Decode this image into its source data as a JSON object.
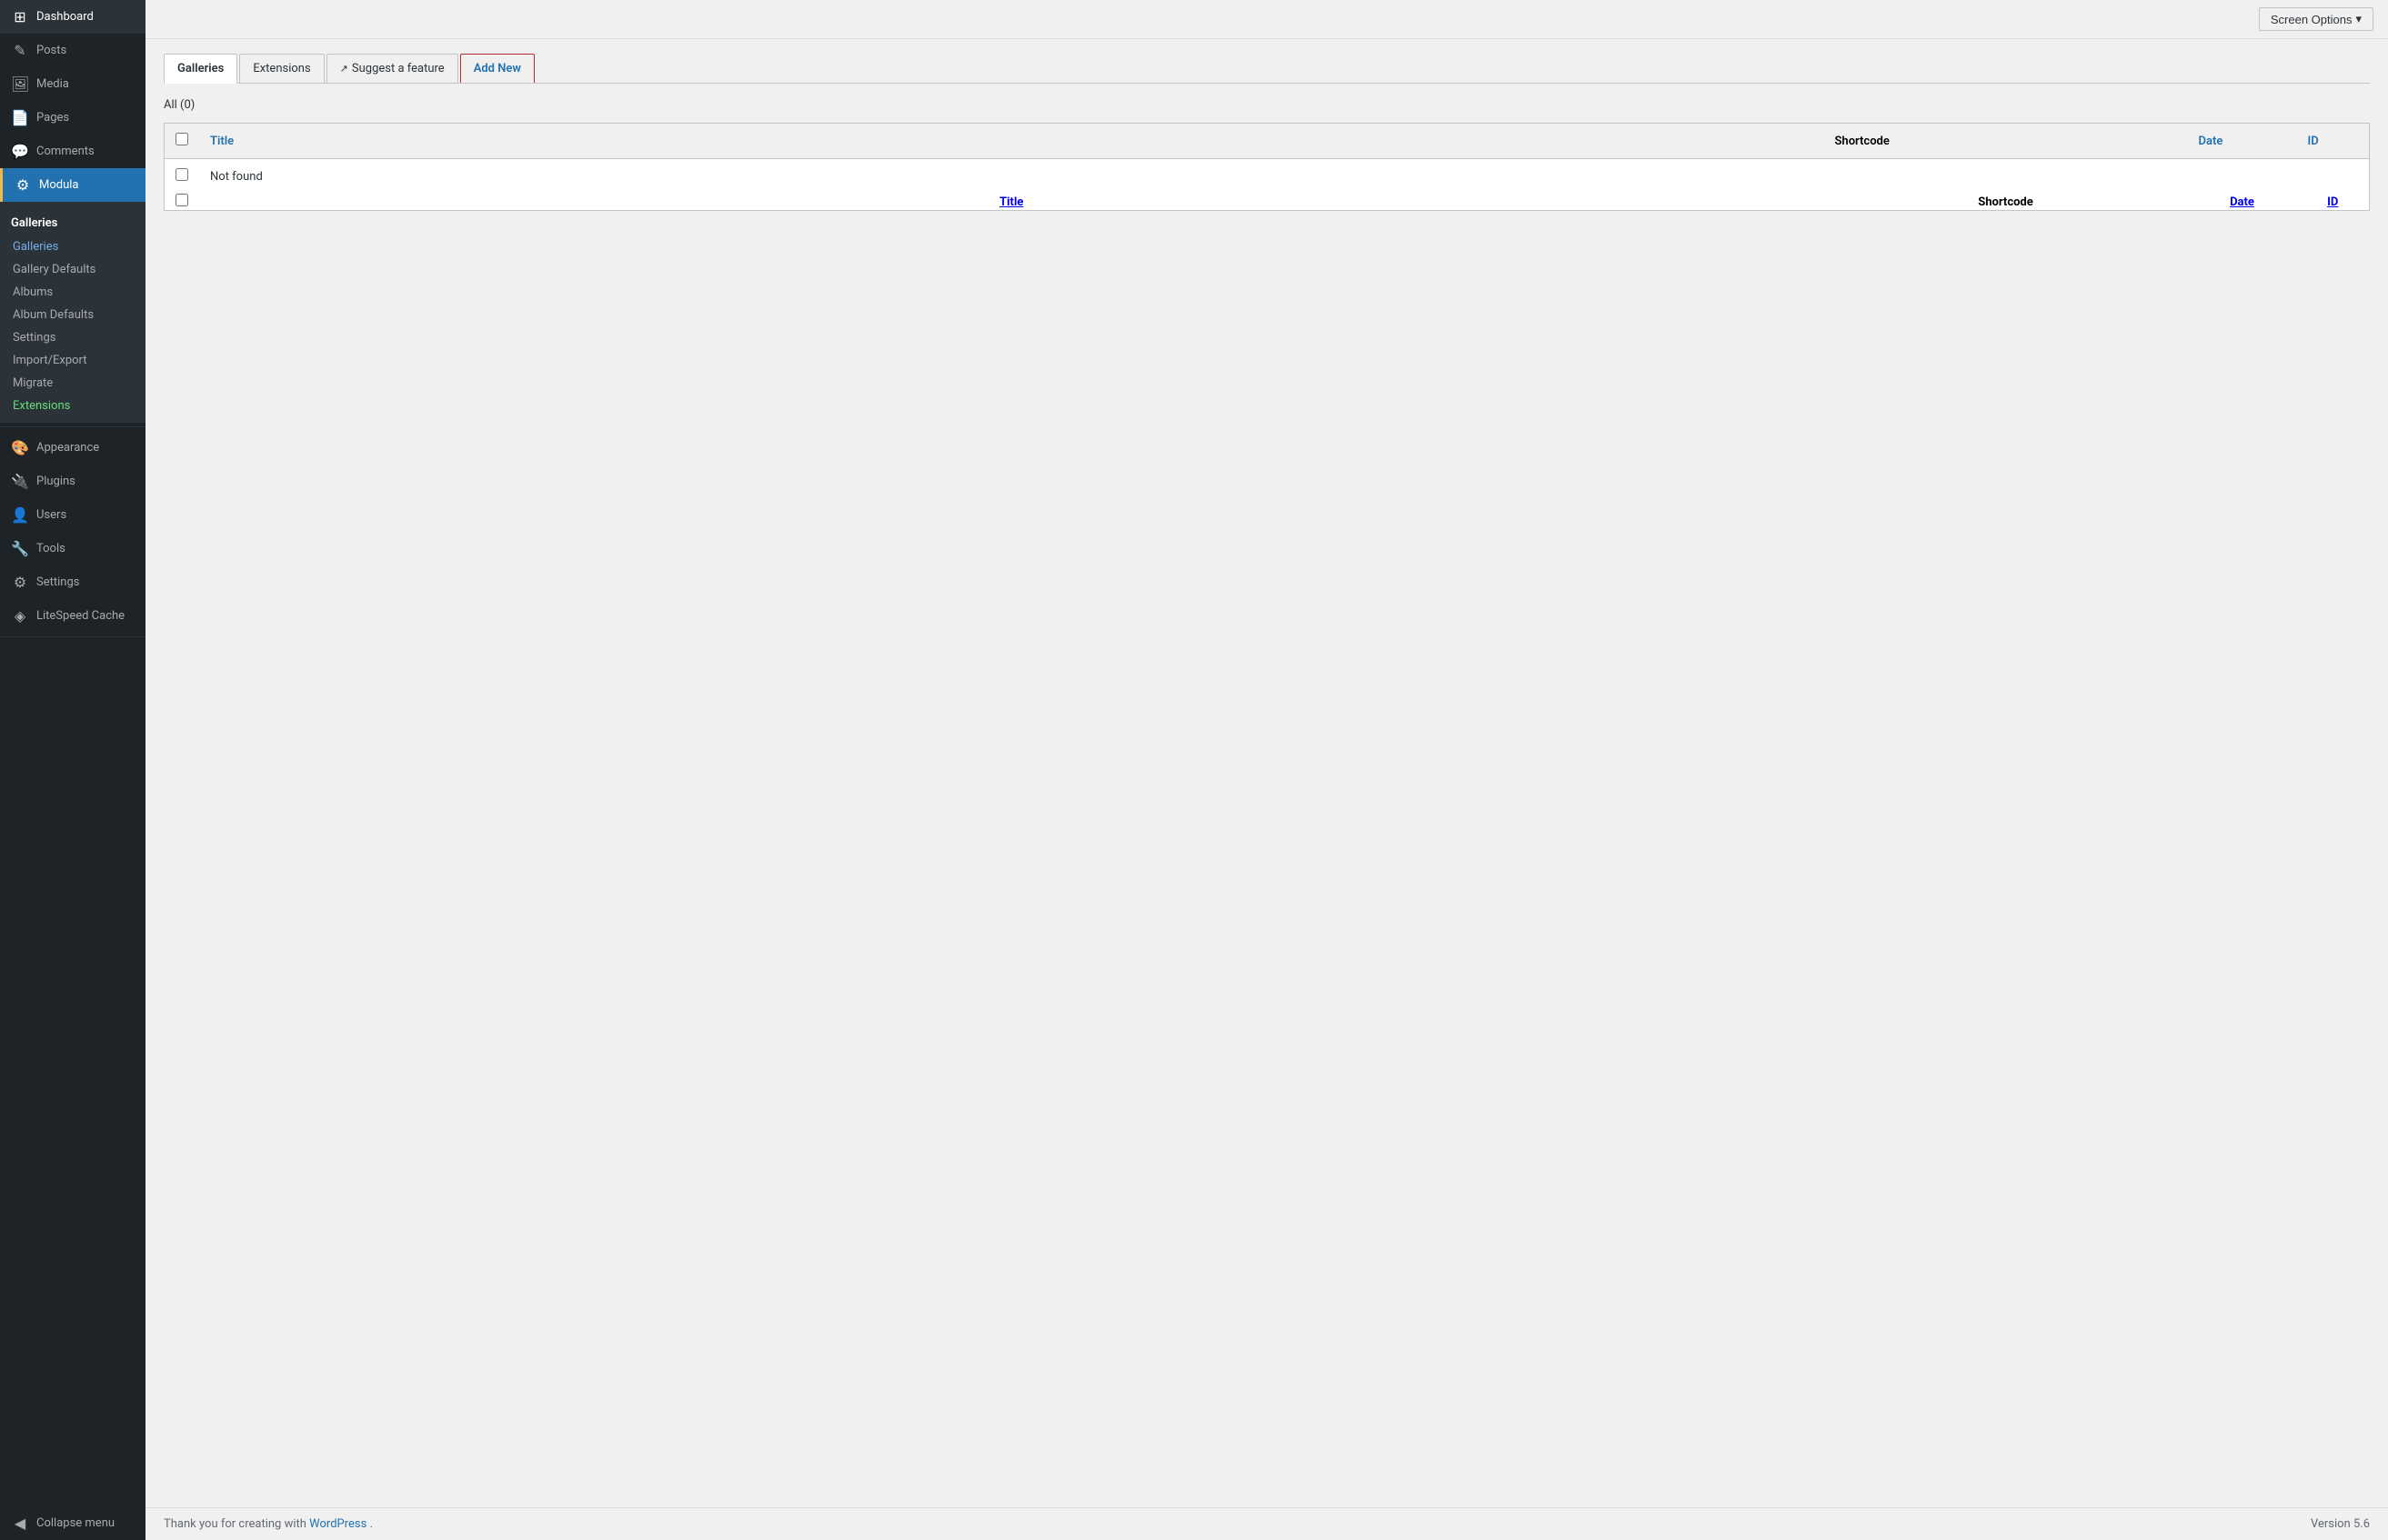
{
  "sidebar": {
    "items": [
      {
        "id": "dashboard",
        "label": "Dashboard",
        "icon": "⊞"
      },
      {
        "id": "posts",
        "label": "Posts",
        "icon": "📝"
      },
      {
        "id": "media",
        "label": "Media",
        "icon": "🖼"
      },
      {
        "id": "pages",
        "label": "Pages",
        "icon": "📄"
      },
      {
        "id": "comments",
        "label": "Comments",
        "icon": "💬"
      },
      {
        "id": "modula",
        "label": "Modula",
        "icon": "⚙",
        "active": true
      }
    ],
    "modula_section": {
      "title": "Galleries",
      "sub_items": [
        {
          "id": "galleries",
          "label": "Galleries",
          "active": true
        },
        {
          "id": "gallery-defaults",
          "label": "Gallery Defaults"
        },
        {
          "id": "albums",
          "label": "Albums"
        },
        {
          "id": "album-defaults",
          "label": "Album Defaults"
        },
        {
          "id": "settings",
          "label": "Settings"
        },
        {
          "id": "import-export",
          "label": "Import/Export"
        },
        {
          "id": "migrate",
          "label": "Migrate"
        },
        {
          "id": "extensions",
          "label": "Extensions",
          "green": true
        }
      ]
    },
    "bottom_items": [
      {
        "id": "appearance",
        "label": "Appearance",
        "icon": "🎨"
      },
      {
        "id": "plugins",
        "label": "Plugins",
        "icon": "🔌"
      },
      {
        "id": "users",
        "label": "Users",
        "icon": "👤"
      },
      {
        "id": "tools",
        "label": "Tools",
        "icon": "🔧"
      },
      {
        "id": "settings",
        "label": "Settings",
        "icon": "⚙"
      },
      {
        "id": "litespeed",
        "label": "LiteSpeed Cache",
        "icon": "◈"
      }
    ],
    "collapse_label": "Collapse menu"
  },
  "topbar": {
    "screen_options_label": "Screen Options",
    "chevron": "▾"
  },
  "tabs": [
    {
      "id": "galleries",
      "label": "Galleries",
      "active": true
    },
    {
      "id": "extensions",
      "label": "Extensions"
    },
    {
      "id": "suggest",
      "label": "Suggest a feature",
      "external": true
    },
    {
      "id": "add-new",
      "label": "Add New",
      "highlighted": true
    }
  ],
  "filter": {
    "all_label": "All",
    "count": "(0)"
  },
  "table": {
    "columns": [
      {
        "id": "check",
        "label": ""
      },
      {
        "id": "title",
        "label": "Title",
        "link": true
      },
      {
        "id": "shortcode",
        "label": "Shortcode"
      },
      {
        "id": "date",
        "label": "Date",
        "link": true
      },
      {
        "id": "id",
        "label": "ID",
        "link": true
      }
    ],
    "rows": [
      {
        "id": "not-found",
        "title": "Not found",
        "shortcode": "",
        "date": "",
        "item_id": ""
      }
    ]
  },
  "footer": {
    "thank_you_text": "Thank you for creating with",
    "wp_link_label": "WordPress",
    "version_label": "Version 5.6"
  }
}
